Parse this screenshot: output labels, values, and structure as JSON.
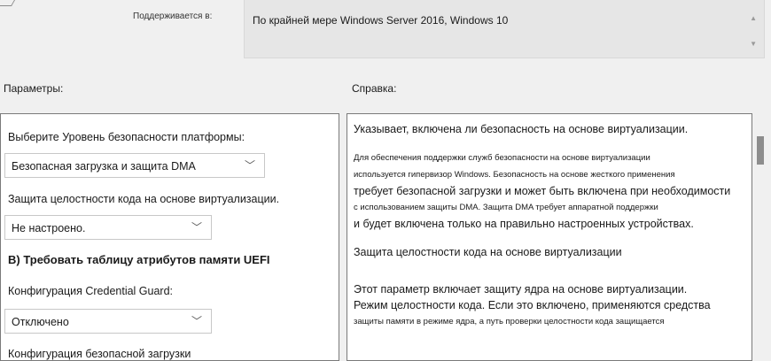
{
  "supported": {
    "label": "Поддерживается в:",
    "value": "По крайней мере Windows Server 2016, Windows 10"
  },
  "panels": {
    "options_title": "Параметры:",
    "help_title": "Справка:"
  },
  "options": {
    "platform_label": "Выберите Уровень безопасности платформы:",
    "platform_value": "Безопасная загрузка и защита DMA",
    "hvci_label": "Защита целостности кода на основе виртуализации.",
    "hvci_value": "Не настроено.",
    "uefi_heading": "В) Требовать таблицу атрибутов памяти UEFI",
    "cg_label": "Конфигурация Credential Guard:",
    "cg_value": "Отключено",
    "partial_label": "Конфигурация безопасной загрузки"
  },
  "help": {
    "p1": "Указывает, включена ли безопасность на основе виртуализации.",
    "p2_l1": "Для обеспечения поддержки служб безопасности на основе виртуализации",
    "p2_l2": "используется гипервизор Windows. Безопасность на основе жесткого применения",
    "p2_l3": "требует безопасной загрузки и может быть включена при необходимости",
    "p2_l4": "с использованием защиты DMA. Защита DMA требует аппаратной поддержки",
    "p2_l5": "и будет включена только на правильно настроенных устройствах.",
    "p3": "Защита целостности кода на основе виртуализации",
    "p4_l1": "Этот параметр включает защиту ядра на основе виртуализации.",
    "p4_l2": "Режим целостности кода. Если это включено, применяются средства",
    "p4_l3": "защиты памяти в режиме ядра, а путь проверки целостности кода защищается"
  },
  "icons": {
    "chevron": "chevron-down-icon",
    "scroll_up": "scroll-up-icon",
    "scroll_down": "scroll-down-icon"
  }
}
